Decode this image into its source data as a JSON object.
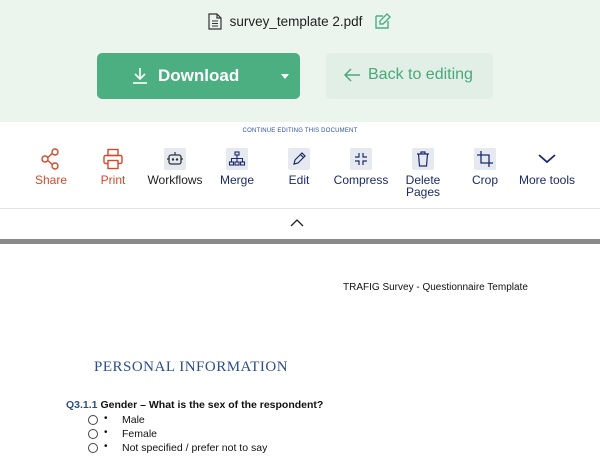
{
  "file": {
    "name": "survey_template 2.pdf"
  },
  "actions": {
    "download_label": "Download",
    "back_label": "Back to editing"
  },
  "toolbar": {
    "continue_text": "CONTINUE EDITING THIS DOCUMENT",
    "tools": [
      {
        "label": "Share",
        "icon": "share-icon"
      },
      {
        "label": "Print",
        "icon": "printer-icon"
      },
      {
        "label": "Workflows",
        "icon": "robot-icon"
      },
      {
        "label": "Merge",
        "icon": "merge-icon"
      },
      {
        "label": "Edit",
        "icon": "pencil-icon"
      },
      {
        "label": "Compress",
        "icon": "compress-icon"
      },
      {
        "label": "Delete Pages",
        "icon": "trash-icon"
      },
      {
        "label": "Crop",
        "icon": "crop-icon"
      },
      {
        "label": "More tools",
        "icon": "chevron-down-icon"
      }
    ]
  },
  "colors": {
    "accent_green": "#4caf82",
    "top_background": "#ebf5ee",
    "tool_text": "#1b2a6b",
    "share_print": "#d24a2c"
  },
  "document": {
    "header": "TRAFIG Survey - Questionnaire Template",
    "section_heading": "PERSONAL INFORMATION",
    "question": {
      "number": "Q3.1.1",
      "text": "Gender – What is the sex of the respondent?"
    },
    "options": [
      "Male",
      "Female",
      "Not specified / prefer not to say"
    ]
  }
}
